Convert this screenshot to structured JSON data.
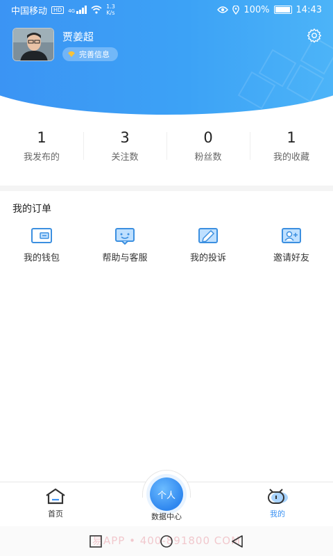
{
  "status_bar": {
    "carrier": "中国移动",
    "network_badge": "HD",
    "signal": "4G",
    "speed": "1.3",
    "speed_unit": "K/s",
    "battery": "100%",
    "time": "14:43"
  },
  "profile": {
    "name": "贾姜超",
    "complete_info_label": "完善信息"
  },
  "stats": [
    {
      "value": "1",
      "label": "我发布的"
    },
    {
      "value": "3",
      "label": "关注数"
    },
    {
      "value": "0",
      "label": "粉丝数"
    },
    {
      "value": "1",
      "label": "我的收藏"
    }
  ],
  "orders": {
    "title": "我的订单",
    "items": [
      {
        "label": "我的钱包",
        "icon": "wallet-icon"
      },
      {
        "label": "帮助与客服",
        "icon": "customer-service-icon"
      },
      {
        "label": "我的投诉",
        "icon": "complaint-icon"
      },
      {
        "label": "邀请好友",
        "icon": "invite-friend-icon"
      }
    ]
  },
  "bottom_nav": {
    "home": "首页",
    "center_button": "个人",
    "center_label": "数据中心",
    "me": "我的"
  },
  "watermark": "易APP • 400-891800 COM",
  "colors": {
    "primary": "#3b92f3",
    "header_gradient_end": "#4fb7f8"
  }
}
